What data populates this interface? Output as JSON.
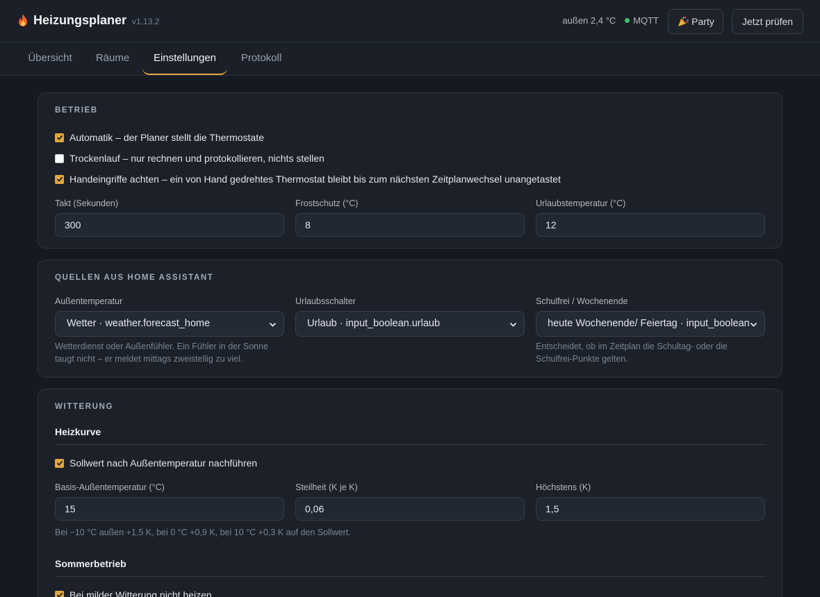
{
  "header": {
    "title": "Heizungsplaner",
    "version": "v1.13.2",
    "outside_temp": "außen 2,4 °C",
    "mqtt_label": "MQTT",
    "party_label": "Party",
    "check_label": "Jetzt prüfen",
    "mqtt_color": "#3fbf6f",
    "accent_color": "#e2a640",
    "icons": [
      "flame-icon",
      "party-popper-icon"
    ]
  },
  "tabs": [
    {
      "label": "Übersicht",
      "active": false
    },
    {
      "label": "Räume",
      "active": false
    },
    {
      "label": "Einstellungen",
      "active": true
    },
    {
      "label": "Protokoll",
      "active": false
    }
  ],
  "betrieb": {
    "title": "BETRIEB",
    "options": [
      {
        "label": "Automatik – der Planer stellt die Thermostate",
        "checked": true
      },
      {
        "label": "Trockenlauf – nur rechnen und protokollieren, nichts stellen",
        "checked": false
      },
      {
        "label": "Handeingriffe achten – ein von Hand gedrehtes Thermostat bleibt bis zum nächsten Zeitplanwechsel unangetastet",
        "checked": true
      }
    ],
    "fields": [
      {
        "label": "Takt (Sekunden)",
        "value": "300"
      },
      {
        "label": "Frostschutz (°C)",
        "value": "8"
      },
      {
        "label": "Urlaubstemperatur (°C)",
        "value": "12"
      }
    ]
  },
  "quellen": {
    "title": "QUELLEN AUS HOME ASSISTANT",
    "selects": [
      {
        "label": "Außentemperatur",
        "value": "Wetter · weather.forecast_home",
        "hint": "Wetterdienst oder Außenfühler. Ein Fühler in der Sonne taugt nicht – er meldet mittags zweistellig zu viel."
      },
      {
        "label": "Urlaubsschalter",
        "value": "Urlaub · input_boolean.urlaub",
        "hint": ""
      },
      {
        "label": "Schulfrei / Wochenende",
        "value": "heute Wochenende/ Feiertag · input_boolean.",
        "hint": "Entscheidet, ob im Zeitplan die Schultag- oder die Schulfrei-Punkte gelten."
      }
    ]
  },
  "witterung": {
    "title": "WITTERUNG",
    "heizkurve": {
      "heading": "Heizkurve",
      "option": {
        "label": "Sollwert nach Außentemperatur nachführen",
        "checked": true
      },
      "fields": [
        {
          "label": "Basis-Außentemperatur (°C)",
          "value": "15"
        },
        {
          "label": "Steilheit (K je K)",
          "value": "0,06"
        },
        {
          "label": "Höchstens (K)",
          "value": "1,5"
        }
      ],
      "hint": "Bei −10 °C außen +1,5 K, bei 0 °C +0,9 K, bei 10 °C +0,3 K auf den Sollwert."
    },
    "sommer": {
      "heading": "Sommerbetrieb",
      "option": {
        "label": "Bei milder Witterung nicht heizen",
        "checked": true
      }
    }
  }
}
